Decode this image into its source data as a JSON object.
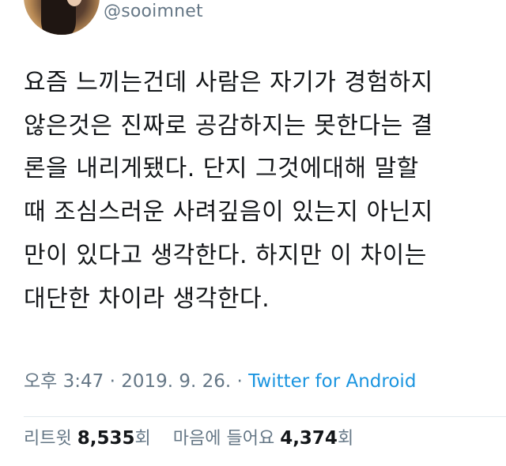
{
  "user": {
    "handle": "@sooimnet"
  },
  "tweet": {
    "lines": [
      "요즘 느끼는건데 사람은 자기가 경험하지",
      "않은것은 진짜로 공감하지는 못한다는 결",
      "론을 내리게됐다. 단지 그것에대해 말할",
      "때 조심스러운 사려깊음이 있는지 아닌지",
      "만이 있다고 생각한다. 하지만 이 차이는",
      "대단한 차이라 생각한다."
    ],
    "time": "오후 3:47",
    "separator": "·",
    "date": "2019. 9. 26.",
    "source": "Twitter for Android"
  },
  "stats": {
    "retweets_label": "리트윗",
    "retweets_count": "8,535",
    "retweets_unit": "회",
    "likes_label": "마음에 들어요",
    "likes_count": "4,374",
    "likes_unit": "회"
  }
}
